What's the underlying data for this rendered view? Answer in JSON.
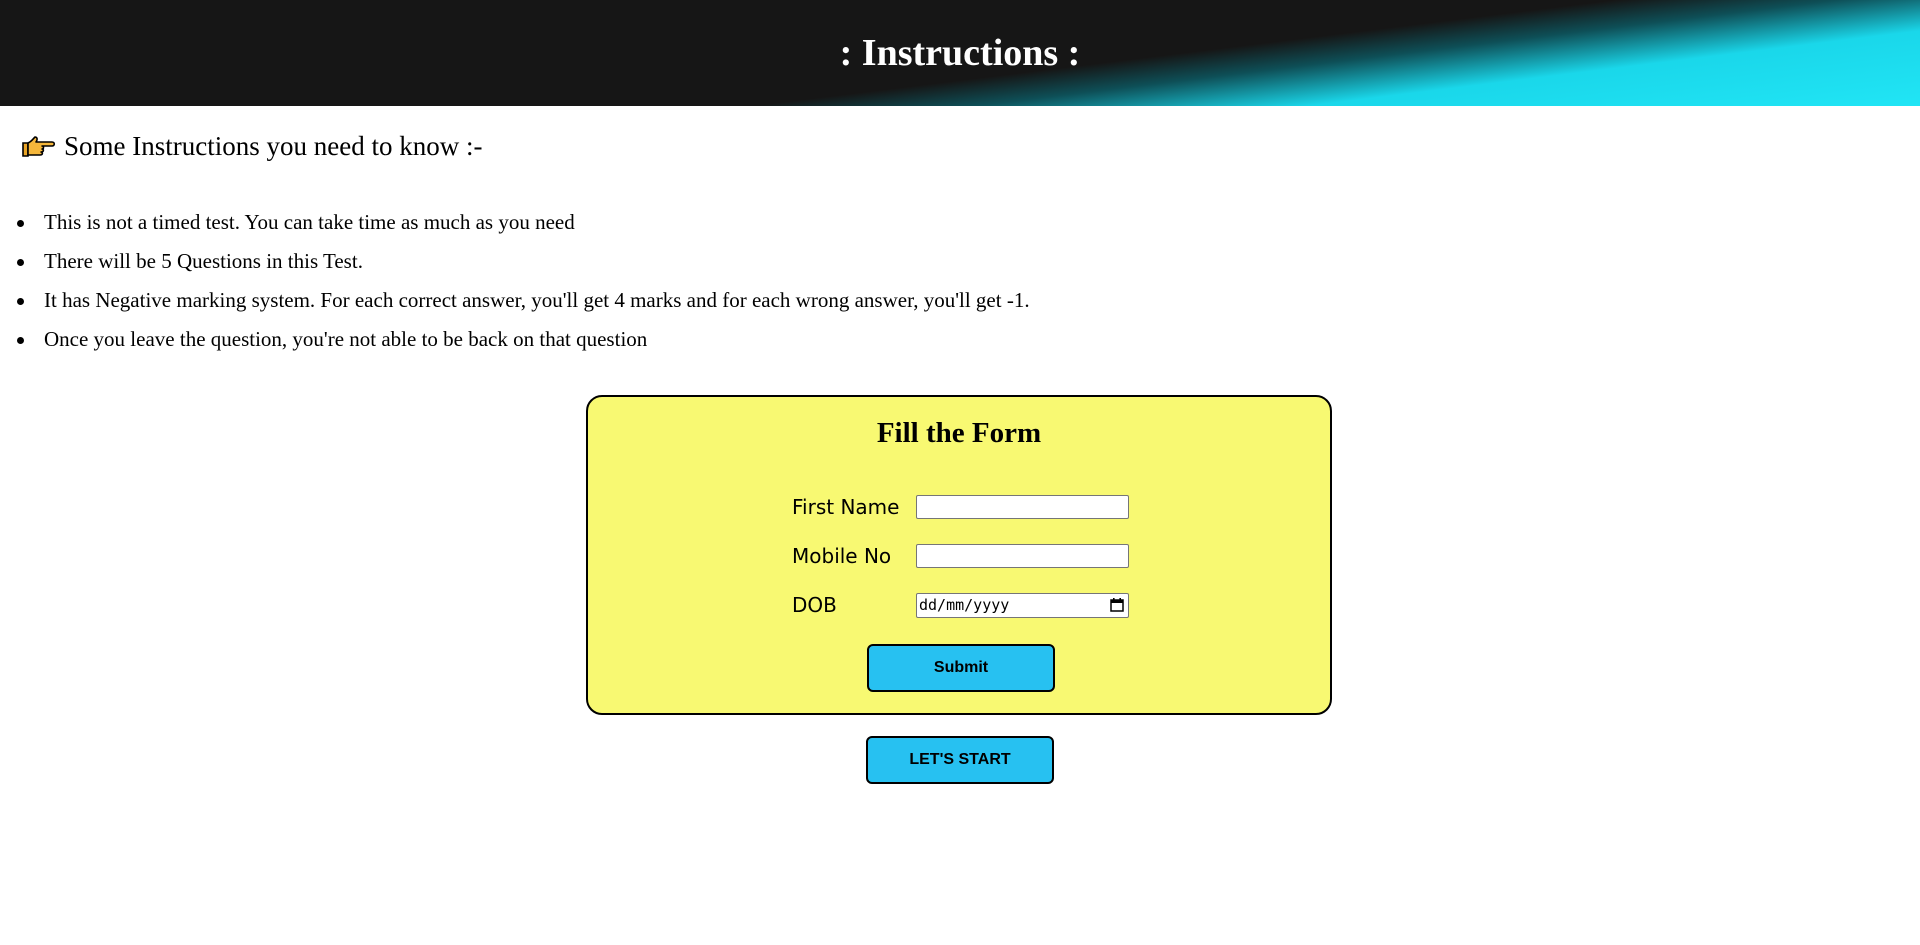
{
  "header": {
    "title": ": Instructions :"
  },
  "intro": {
    "icon": "pointing-hand-icon",
    "text": "Some Instructions you need to know :-"
  },
  "rules": [
    "This is not a timed test. You can take time as much as you need",
    "There will be 5 Questions in this Test.",
    "It has Negative marking system. For each correct answer, you'll get 4 marks and for each wrong answer, you'll get -1.",
    "Once you leave the question, you're not able to be back on that question"
  ],
  "form": {
    "title": "Fill the Form",
    "first_name_label": "First Name",
    "first_name_value": "",
    "mobile_label": "Mobile No",
    "mobile_value": "",
    "dob_label": "DOB",
    "dob_placeholder": "dd/mm/yyyy",
    "submit_label": "Submit"
  },
  "start_button": {
    "label": "LET'S START"
  },
  "colors": {
    "header_bg": "#161616",
    "header_accent": "#21e5f5",
    "form_bg": "#f8f972",
    "button_bg": "#27c1f1"
  }
}
